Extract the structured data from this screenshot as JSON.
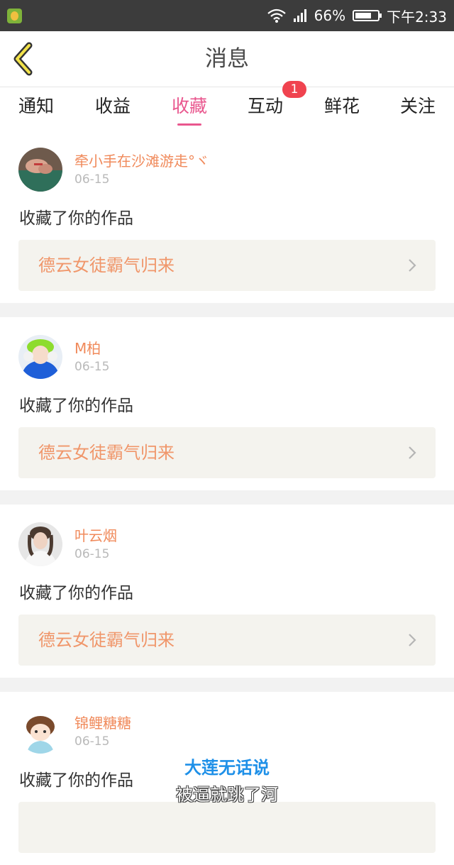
{
  "status_bar": {
    "battery_percent": "66%",
    "time": "下午2:33",
    "icons": [
      "app-icon",
      "wifi-icon",
      "signal-icon",
      "battery-icon"
    ]
  },
  "nav": {
    "title": "消息",
    "back_icon": "chevron-left-icon"
  },
  "tabs": [
    {
      "label": "通知",
      "active": false
    },
    {
      "label": "收益",
      "active": false
    },
    {
      "label": "收藏",
      "active": true
    },
    {
      "label": "互动",
      "active": false,
      "badge": "1"
    },
    {
      "label": "鲜花",
      "active": false
    },
    {
      "label": "关注",
      "active": false
    }
  ],
  "items": [
    {
      "username": "牵小手在沙滩游走°ヾ",
      "date": "06-15",
      "action": "收藏了你的作品",
      "work_title": "德云女徒霸气归来"
    },
    {
      "username": "M柏",
      "date": "06-15",
      "action": "收藏了你的作品",
      "work_title": "德云女徒霸气归来"
    },
    {
      "username": "叶云烟",
      "date": "06-15",
      "action": "收藏了你的作品",
      "work_title": "德云女徒霸气归来"
    },
    {
      "username": "锦鲤糖糖",
      "date": "06-15",
      "action": "收藏了你的作品",
      "work_title": ""
    }
  ],
  "subtitles": {
    "line1": "大莲无话说",
    "line2": "被逼就跳了河"
  },
  "colors": {
    "accent": "#e9578e",
    "username": "#f08a5b",
    "work_title": "#f0966a",
    "badge": "#f0434f",
    "status_bar": "#3c3c3c"
  }
}
